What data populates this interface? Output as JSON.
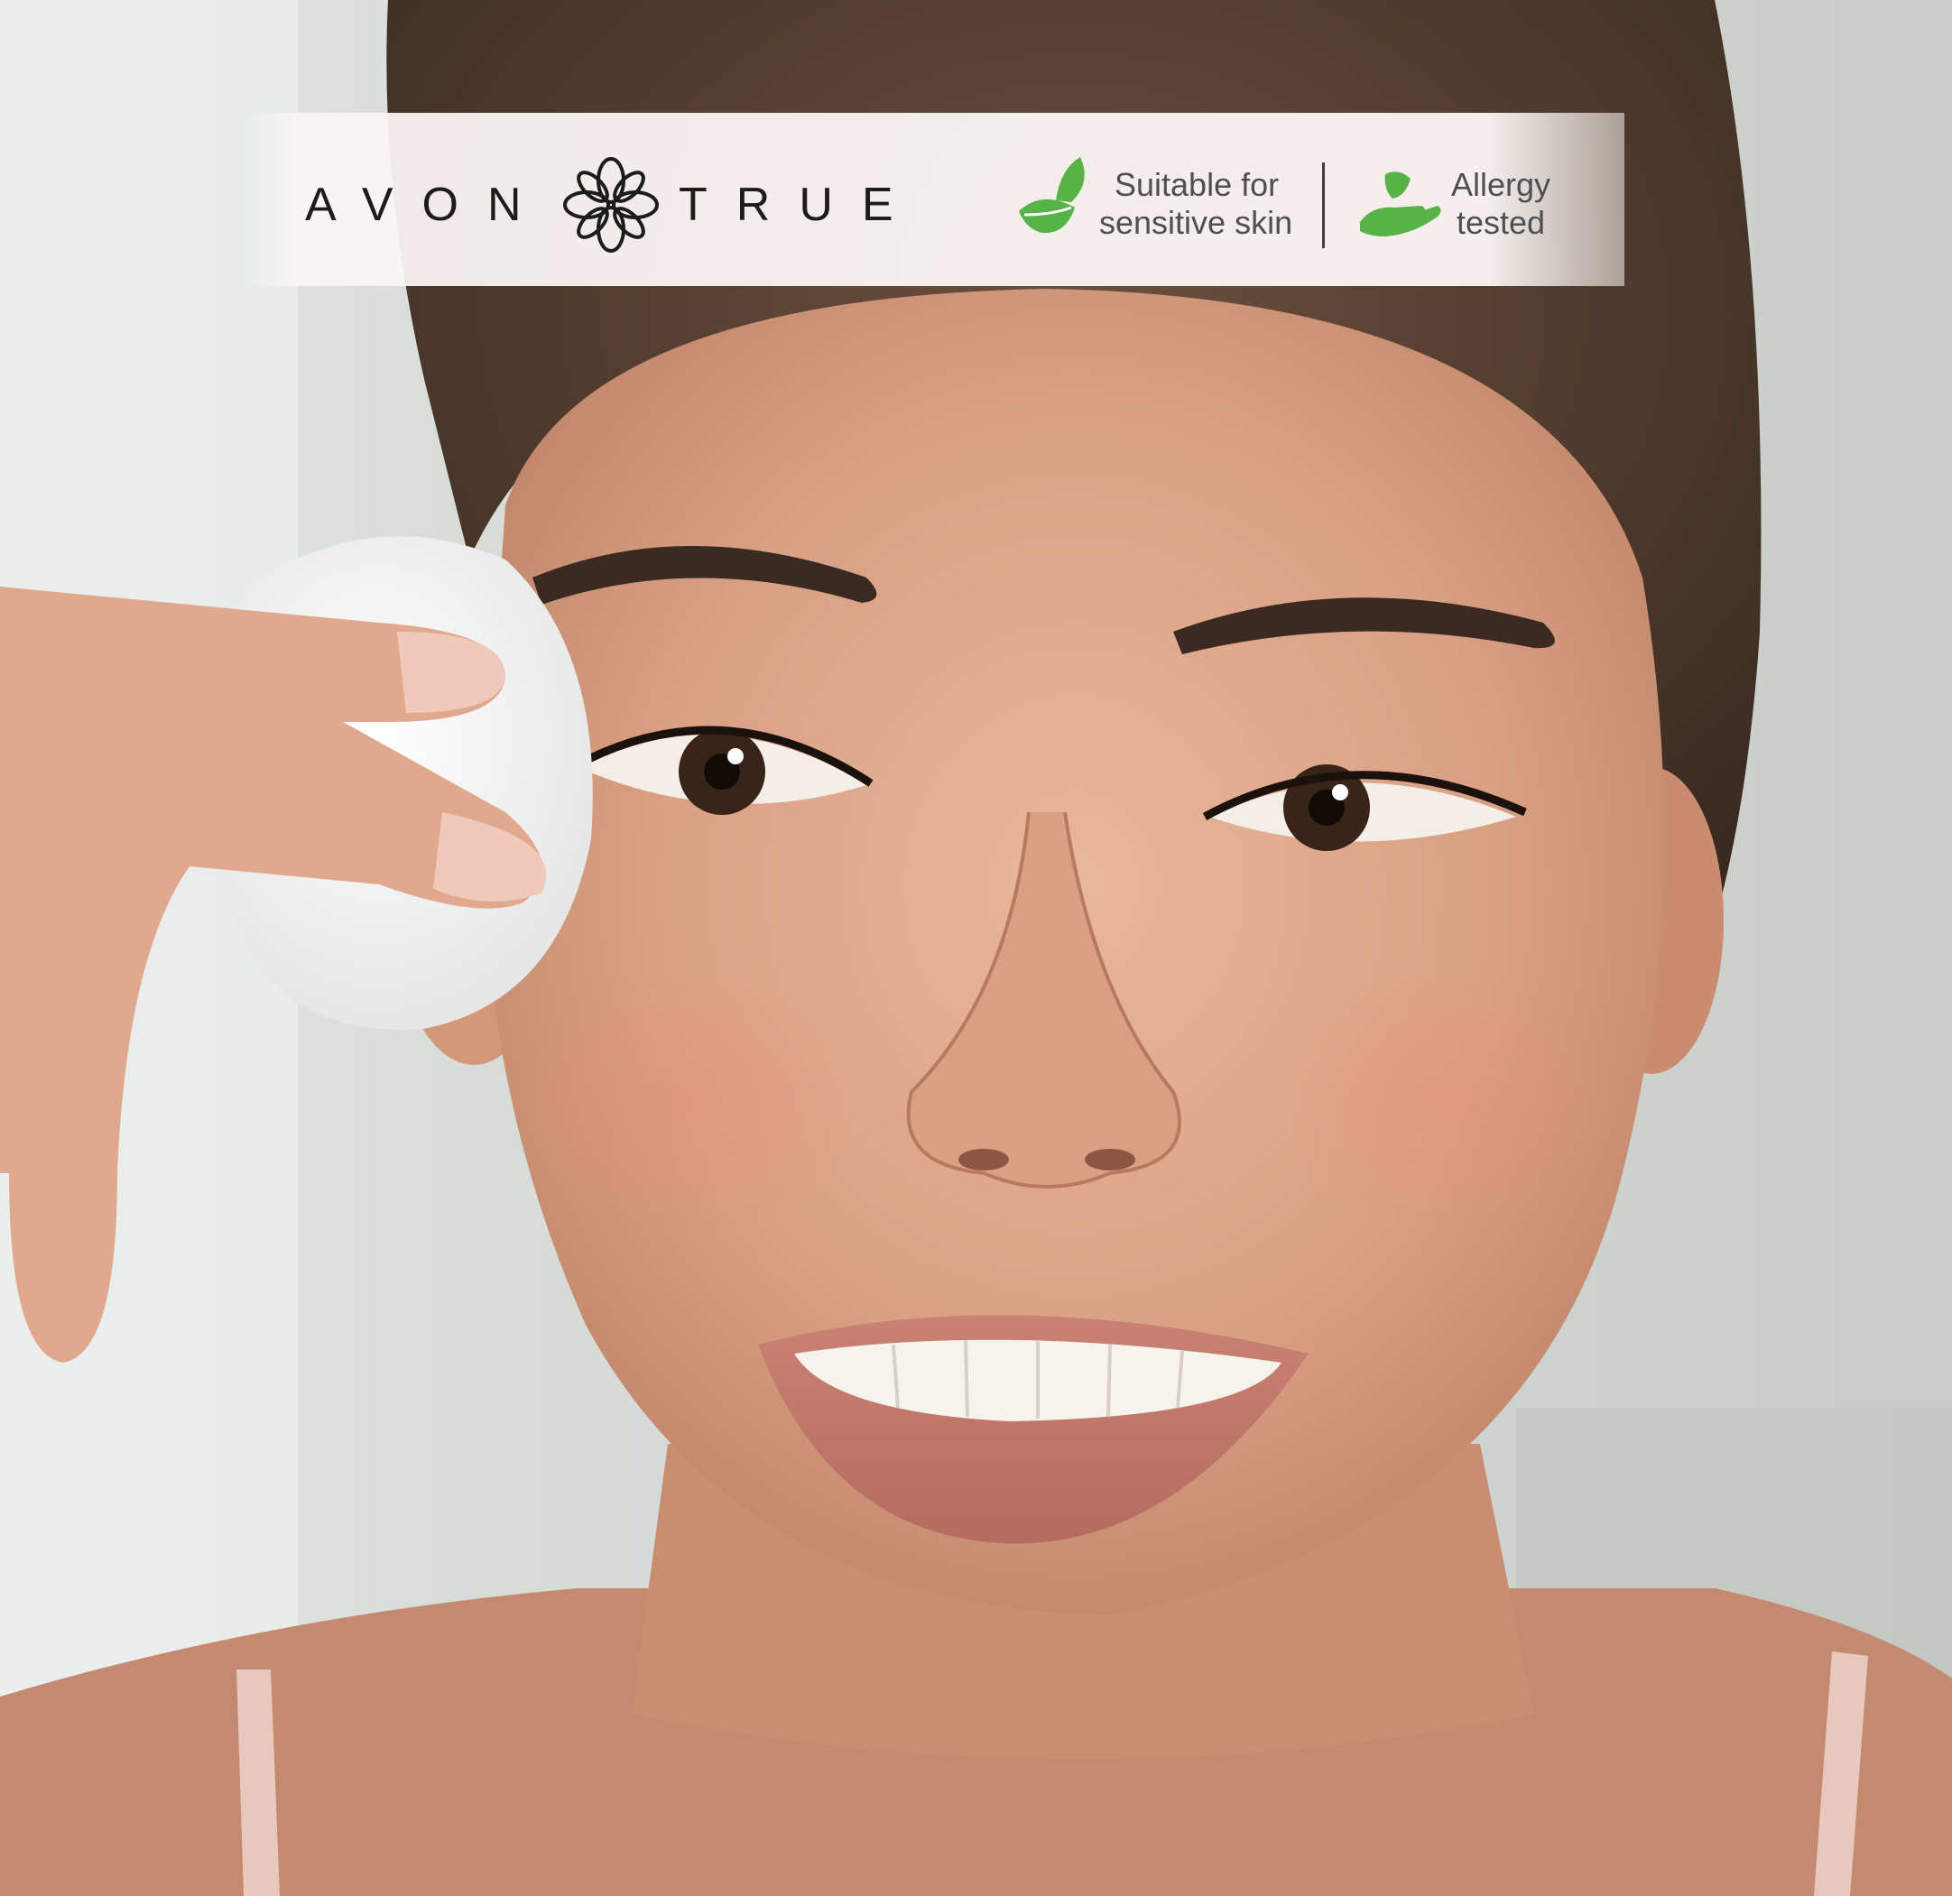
{
  "brand": {
    "word_left": "AVON",
    "word_right": "TRUE",
    "logo_icon": "avon-flower-logo-icon"
  },
  "badges": [
    {
      "icon": "leaf-icon",
      "line1": "Suitable for",
      "line2": "sensitive skin"
    },
    {
      "icon": "hand-leaf-icon",
      "line1": "Allergy",
      "line2": "tested"
    }
  ],
  "colors": {
    "banner": "#faf6f4",
    "brand_text": "#1c1c1c",
    "badge_green": "#56b346",
    "badge_text": "#4f4f4f"
  }
}
